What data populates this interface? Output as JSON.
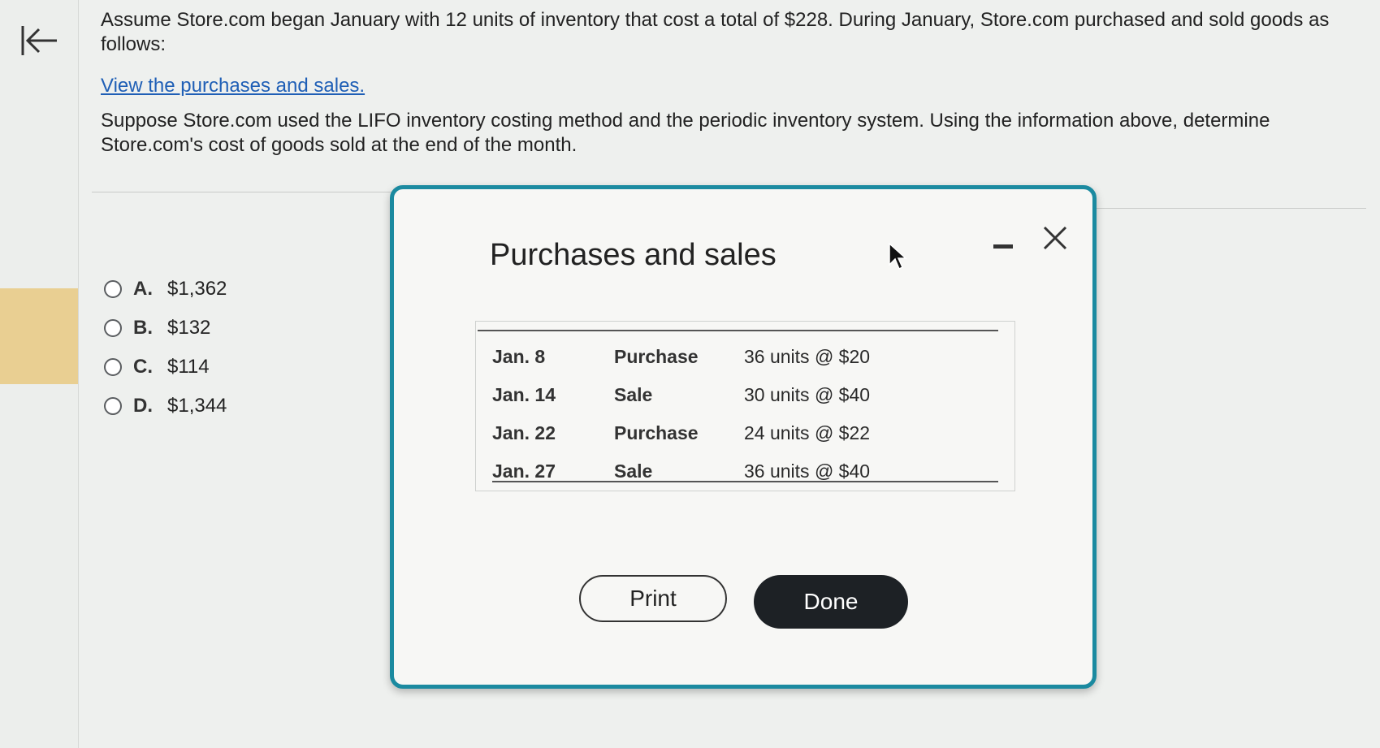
{
  "question": {
    "intro": "Assume Store.com began January with 12 units of inventory that cost a total of $228. During January, Store.com purchased and sold goods as follows:",
    "link_text": "View the purchases and sales.",
    "prompt": "Suppose Store.com used the LIFO inventory costing method and the periodic inventory system. Using the information above, determine Store.com's cost of goods sold at the end of the month."
  },
  "choices": [
    {
      "letter": "A.",
      "value": "$1,362"
    },
    {
      "letter": "B.",
      "value": "$132"
    },
    {
      "letter": "C.",
      "value": "$114"
    },
    {
      "letter": "D.",
      "value": "$1,344"
    }
  ],
  "modal": {
    "title": "Purchases and sales",
    "rows": [
      {
        "date": "Jan. 8",
        "type": "Purchase",
        "detail": "36 units @ $20"
      },
      {
        "date": "Jan. 14",
        "type": "Sale",
        "detail": "30 units @ $40"
      },
      {
        "date": "Jan. 22",
        "type": "Purchase",
        "detail": "24 units @ $22"
      },
      {
        "date": "Jan. 27",
        "type": "Sale",
        "detail": "36 units @ $40"
      }
    ],
    "print_label": "Print",
    "done_label": "Done"
  },
  "colors": {
    "modal_border": "#1b8aa0",
    "link": "#1f5fb6",
    "done_button": "#1d2125",
    "rail_highlight": "#e9cf92"
  }
}
